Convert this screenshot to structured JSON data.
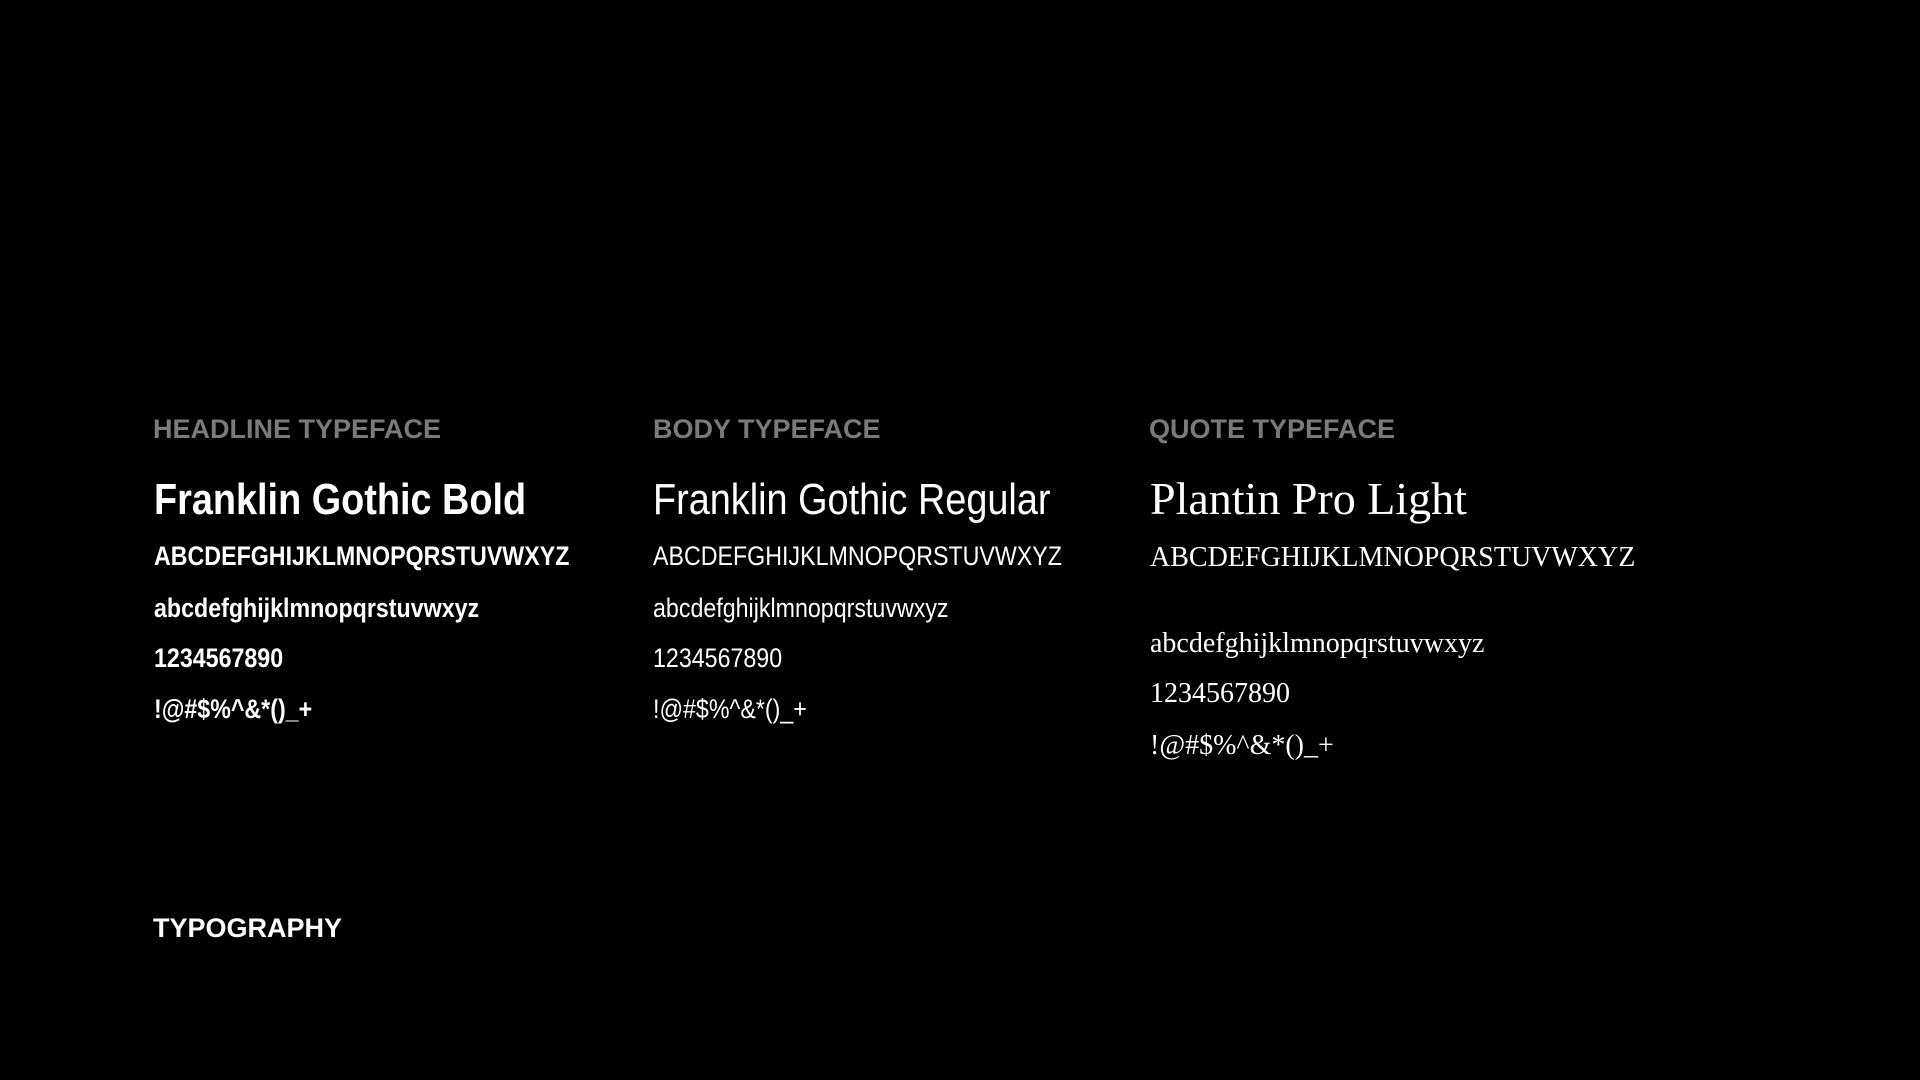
{
  "footer_title": "TYPOGRAPHY",
  "columns": [
    {
      "label": "HEADLINE TYPEFACE",
      "font_name": "Franklin Gothic Bold",
      "uppercase": "ABCDEFGHIJKLMNOPQRSTUVWXYZ",
      "lowercase": "abcdefghijklmnopqrstuvwxyz",
      "digits": "1234567890",
      "symbols": "!@#$%^&*()_+"
    },
    {
      "label": "BODY TYPEFACE",
      "font_name": "Franklin Gothic Regular",
      "uppercase": "ABCDEFGHIJKLMNOPQRSTUVWXYZ",
      "lowercase": "abcdefghijklmnopqrstuvwxyz",
      "digits": "1234567890",
      "symbols": "!@#$%^&*()_+"
    },
    {
      "label": "QUOTE TYPEFACE",
      "font_name": "Plantin Pro Light",
      "uppercase": "ABCDEFGHIJKLMNOPQRSTUVWXYZ",
      "lowercase": "abcdefghijklmnopqrstuvwxyz",
      "digits": "1234567890",
      "symbols": "!@#$%^&*()_+"
    }
  ],
  "colors": {
    "background": "#000000",
    "label": "#7a7a7a",
    "text": "#ffffff"
  }
}
